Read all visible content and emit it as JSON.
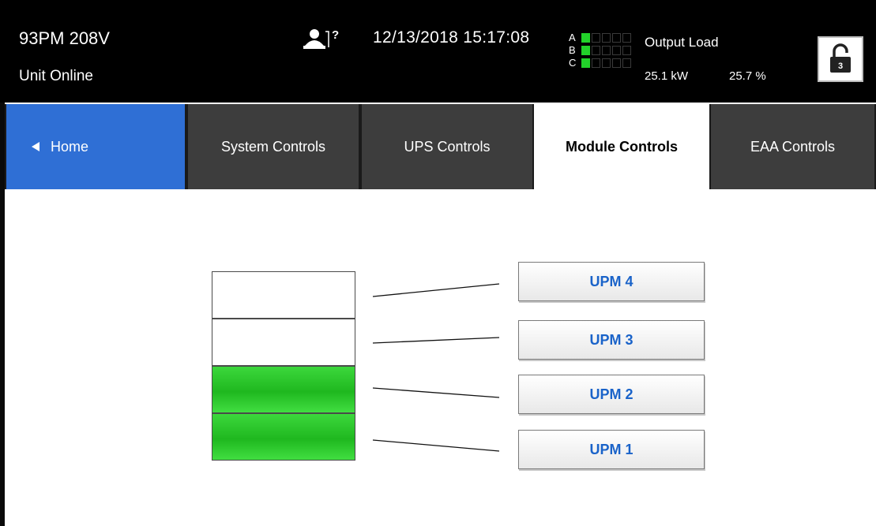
{
  "header": {
    "model": "93PM 208V",
    "status": "Unit Online",
    "help_icon": "user-help-icon",
    "datetime": "12/13/2018 15:17:08",
    "phases": [
      {
        "letter": "A",
        "active_bars": 1
      },
      {
        "letter": "B",
        "active_bars": 1
      },
      {
        "letter": "C",
        "active_bars": 1
      }
    ],
    "output_load": {
      "title": "Output Load",
      "kw": "25.1 kW",
      "percent": "25.7 %"
    },
    "lock_button": {
      "icon": "unlocked-padlock-icon",
      "level": "3"
    }
  },
  "tabs": [
    {
      "label": "Home",
      "icon": "left-arrow-icon"
    },
    {
      "label": "System Controls"
    },
    {
      "label": "UPS Controls"
    },
    {
      "label": "Module Controls",
      "active": true
    },
    {
      "label": "EAA Controls"
    }
  ],
  "modules": {
    "slots": [
      {
        "name": "UPM 4",
        "active": false
      },
      {
        "name": "UPM 3",
        "active": false
      },
      {
        "name": "UPM 2",
        "active": true
      },
      {
        "name": "UPM 1",
        "active": true
      }
    ],
    "buttons": [
      "UPM 4",
      "UPM 3",
      "UPM 2",
      "UPM 1"
    ],
    "active_color": "#22c822",
    "button_text_color": "#1a63c9"
  }
}
